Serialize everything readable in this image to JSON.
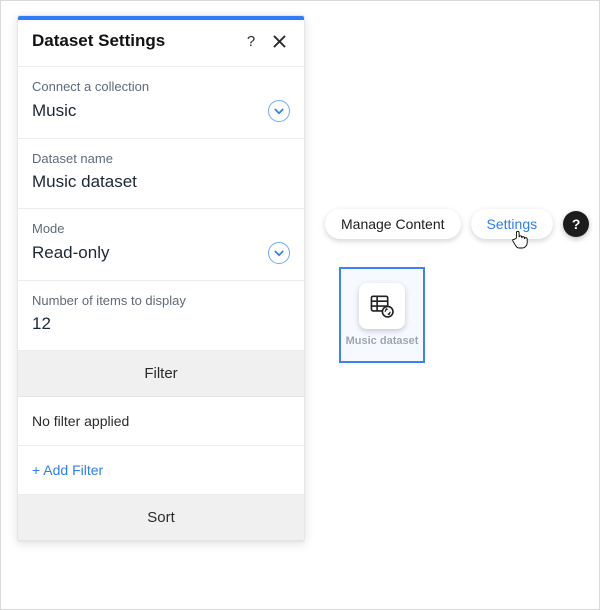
{
  "panel": {
    "title": "Dataset Settings",
    "fields": {
      "collection": {
        "label": "Connect a collection",
        "value": "Music"
      },
      "dataset_name": {
        "label": "Dataset name",
        "value": "Music dataset"
      },
      "mode": {
        "label": "Mode",
        "value": "Read-only"
      },
      "item_count": {
        "label": "Number of items to display",
        "value": "12"
      }
    },
    "filter": {
      "heading": "Filter",
      "none_text": "No filter applied",
      "add_text": "+ Add Filter"
    },
    "sort": {
      "heading": "Sort"
    }
  },
  "toolbar": {
    "manage_label": "Manage Content",
    "settings_label": "Settings",
    "help_label": "?"
  },
  "tile": {
    "label": "Music dataset"
  }
}
